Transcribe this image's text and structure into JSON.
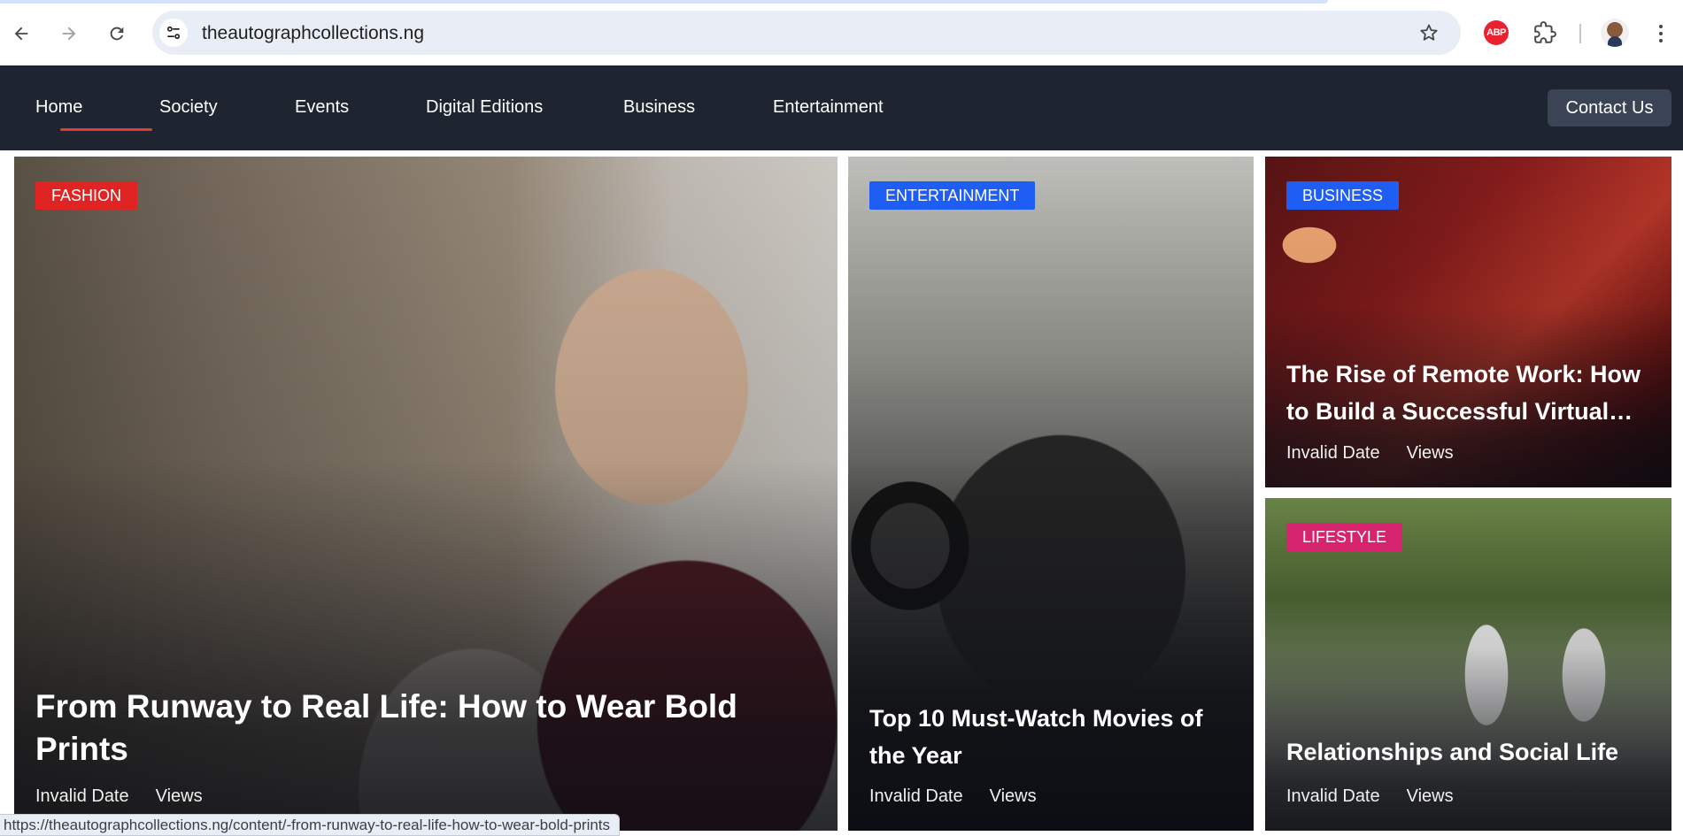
{
  "browser": {
    "url": "theautographcollections.ng",
    "icons": {
      "back": "back-arrow-icon",
      "forward": "forward-arrow-icon",
      "reload": "reload-icon",
      "site_info": "tune-icon",
      "bookmark": "star-icon",
      "adblock": "abp-icon",
      "extensions": "puzzle-icon",
      "menu": "kebab-menu-icon"
    },
    "abp_label": "ABP",
    "status_url": "https://theautographcollections.ng/content/-from-runway-to-real-life-how-to-wear-bold-prints"
  },
  "nav": {
    "items": [
      {
        "label": "Home"
      },
      {
        "label": "Society"
      },
      {
        "label": "Events"
      },
      {
        "label": "Digital Editions"
      },
      {
        "label": "Business"
      },
      {
        "label": "Entertainment"
      }
    ],
    "active": "Home",
    "contact_label": "Contact Us",
    "accent": "#e53935",
    "background": "#1f2530"
  },
  "cards": [
    {
      "category": "FASHION",
      "category_color": "#e02424",
      "title": "From Runway to Real Life: How to Wear Bold Prints",
      "date": "Invalid Date",
      "views": "Views"
    },
    {
      "category": "ENTERTAINMENT",
      "category_color": "#1e5ef5",
      "title": "Top 10 Must-Watch Movies of the Year",
      "date": "Invalid Date",
      "views": "Views"
    },
    {
      "category": "BUSINESS",
      "category_color": "#1e5ef5",
      "title_line1": "The Rise of Remote Work: How",
      "title_line2": "to Build a Successful Virtual…",
      "date": "Invalid Date",
      "views": "Views"
    },
    {
      "category": "LIFESTYLE",
      "category_color": "#d6246e",
      "title": "Relationships and Social Life",
      "date": "Invalid Date",
      "views": "Views"
    }
  ]
}
